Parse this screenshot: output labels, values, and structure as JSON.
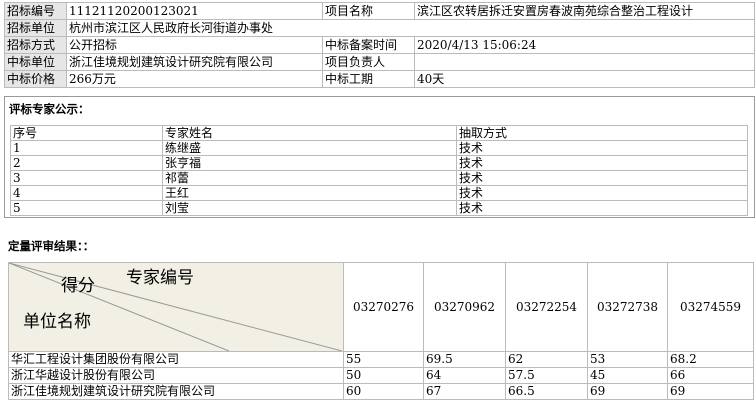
{
  "info": {
    "rows": [
      {
        "l1": "招标编号",
        "v1": "11121120200123021",
        "l2": "项目名称",
        "v2": "滨江区农转居拆迁安置房春波南苑综合整治工程设计"
      },
      {
        "l1": "招标单位",
        "v1": "杭州市滨江区人民政府长河街道办事处",
        "l2": "",
        "v2": ""
      },
      {
        "l1": "招标方式",
        "v1": "公开招标",
        "l2": "中标备案时间",
        "v2": "2020/4/13 15:06:24"
      },
      {
        "l1": "中标单位",
        "v1": "浙江佳境规划建筑设计研究院有限公司",
        "l2": "项目负责人",
        "v2": ""
      },
      {
        "l1": "中标价格",
        "v1": "266万元",
        "l2": "中标工期",
        "v2": "40天"
      }
    ]
  },
  "experts": {
    "title": "评标专家公示：",
    "headers": [
      "序号",
      "专家姓名",
      "抽取方式"
    ],
    "rows": [
      [
        "1",
        "练继盛",
        "技术"
      ],
      [
        "2",
        "张亨福",
        "技术"
      ],
      [
        "3",
        "祁蕾",
        "技术"
      ],
      [
        "4",
        "王红",
        "技术"
      ],
      [
        "5",
        "刘莹",
        "技术"
      ]
    ]
  },
  "results": {
    "title": "定量评审结果：：",
    "corner": {
      "expert_no": "专家编号",
      "score": "得分",
      "unit": "单位名称"
    },
    "expert_ids": [
      "03270276",
      "03270962",
      "03272254",
      "03272738",
      "03274559"
    ],
    "rows": [
      {
        "unit": "华汇工程设计集团股份有限公司",
        "scores": [
          "55",
          "69.5",
          "62",
          "53",
          "68.2"
        ]
      },
      {
        "unit": "浙江华越设计股份有限公司",
        "scores": [
          "50",
          "64",
          "57.5",
          "45",
          "66"
        ]
      },
      {
        "unit": "浙江佳境规划建筑设计研究院有限公司",
        "scores": [
          "60",
          "67",
          "66.5",
          "69",
          "69"
        ]
      }
    ]
  }
}
